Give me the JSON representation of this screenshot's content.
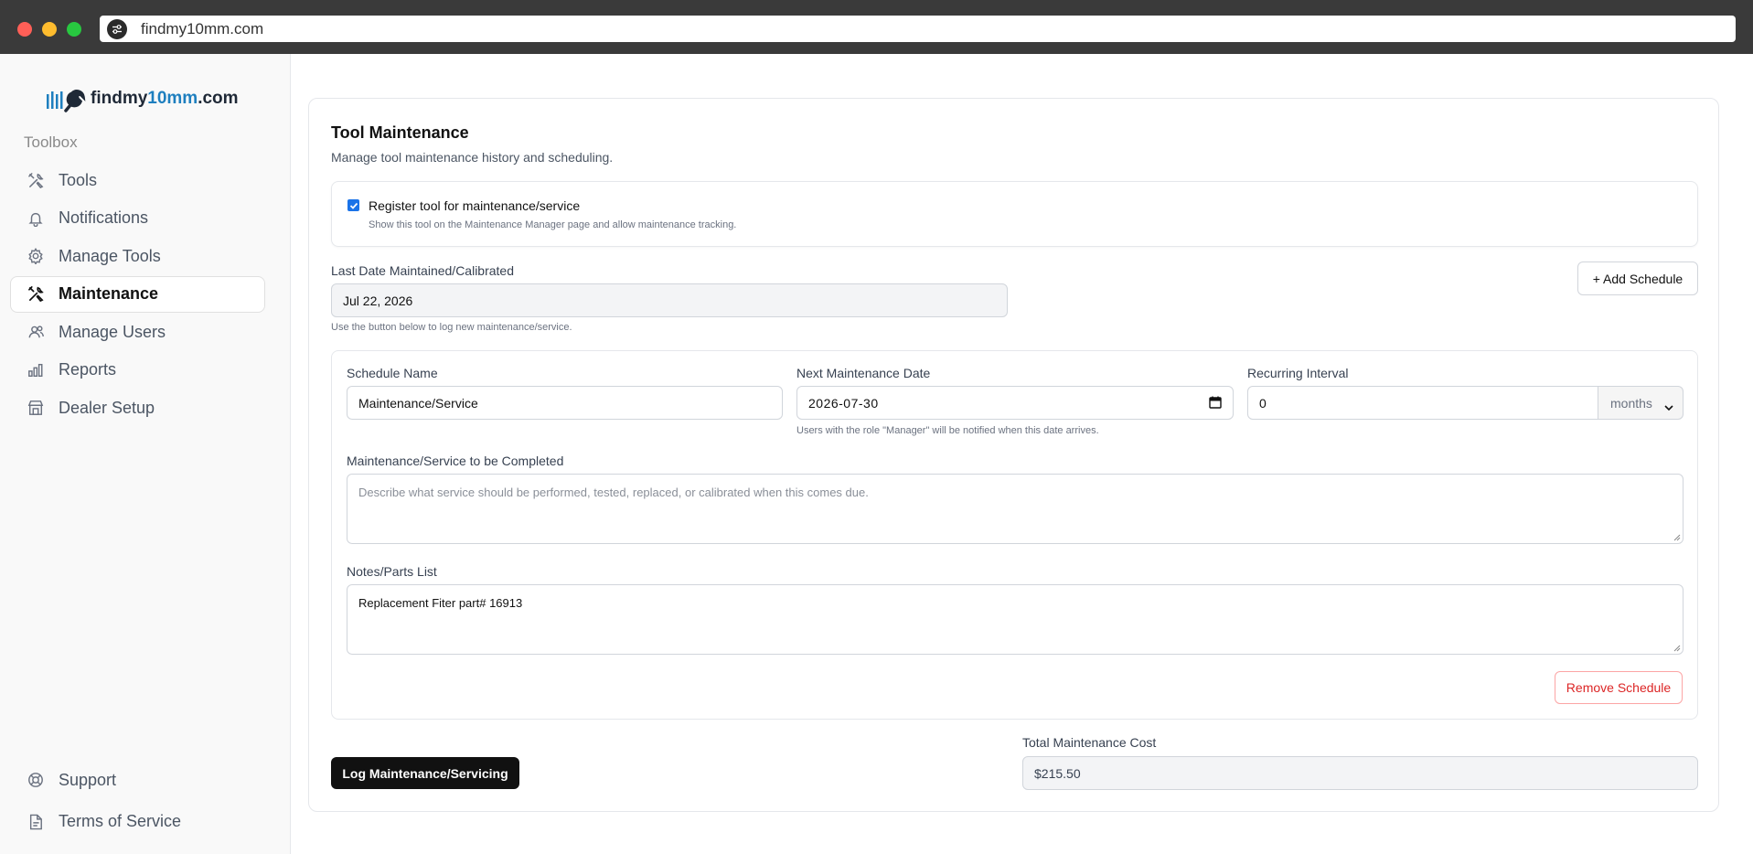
{
  "browser": {
    "url": "findmy10mm.com"
  },
  "sidebar": {
    "logo": {
      "part1": "findmy",
      "part2": "10mm",
      "part3": ".com"
    },
    "section_label": "Toolbox",
    "items": [
      {
        "label": "Tools",
        "icon": "tools-icon"
      },
      {
        "label": "Notifications",
        "icon": "bell-icon"
      },
      {
        "label": "Manage Tools",
        "icon": "gear-icon"
      },
      {
        "label": "Maintenance",
        "icon": "tools-icon",
        "active": true
      },
      {
        "label": "Manage Users",
        "icon": "users-icon"
      },
      {
        "label": "Reports",
        "icon": "bar-chart-icon"
      },
      {
        "label": "Dealer Setup",
        "icon": "store-icon"
      }
    ],
    "bottom_items": [
      {
        "label": "Support",
        "icon": "lifebuoy-icon"
      },
      {
        "label": "Terms of Service",
        "icon": "document-icon"
      }
    ]
  },
  "main": {
    "title": "Tool Maintenance",
    "subtitle": "Manage tool maintenance history and scheduling.",
    "register": {
      "checked": true,
      "label": "Register tool for maintenance/service",
      "help": "Show this tool on the Maintenance Manager page and allow maintenance tracking."
    },
    "last_date": {
      "label": "Last Date Maintained/Calibrated",
      "value": "Jul 22, 2026",
      "help": "Use the button below to log new maintenance/service."
    },
    "add_schedule_label": "+ Add Schedule",
    "schedule": {
      "name_label": "Schedule Name",
      "name_value": "Maintenance/Service",
      "next_date_label": "Next Maintenance Date",
      "next_date_value": "2026-07-30",
      "next_date_help": "Users with the role \"Manager\" will be notified when this date arrives.",
      "interval_label": "Recurring Interval",
      "interval_value": "0",
      "interval_unit": "months",
      "service_label": "Maintenance/Service to be Completed",
      "service_placeholder": "Describe what service should be performed, tested, replaced, or calibrated when this comes due.",
      "notes_label": "Notes/Parts List",
      "notes_value": "Replacement Fiter part# 16913",
      "remove_label": "Remove Schedule"
    },
    "log_button_label": "Log Maintenance/Servicing",
    "total_cost": {
      "label": "Total Maintenance Cost",
      "value": "$215.50"
    }
  },
  "colors": {
    "accent": "#1e7fbf",
    "checkbox": "#1a73e8",
    "danger": "#dc2626",
    "primary_button": "#111111"
  }
}
